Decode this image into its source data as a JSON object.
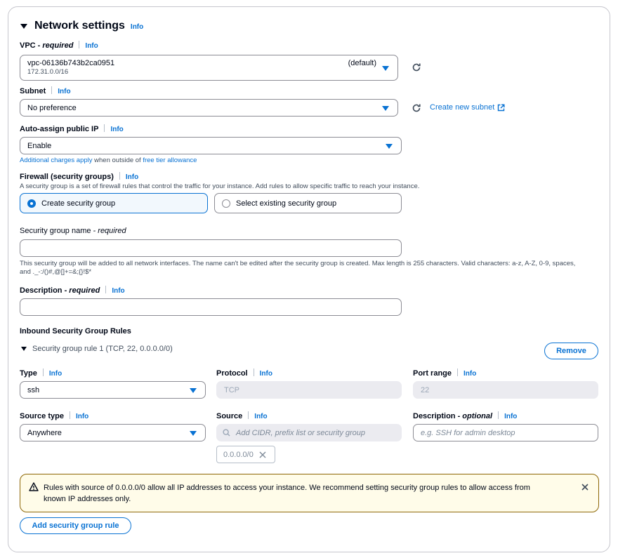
{
  "section": {
    "title": "Network settings",
    "info": "Info"
  },
  "vpc": {
    "label": "VPC - ",
    "label_req": "required",
    "info": "Info",
    "value": "vpc-06136b743b2ca0951",
    "sub": "172.31.0.0/16",
    "tag": "(default)"
  },
  "subnet": {
    "label": "Subnet",
    "info": "Info",
    "value": "No preference",
    "create_link": "Create new subnet"
  },
  "auto_ip": {
    "label": "Auto-assign public IP",
    "info": "Info",
    "value": "Enable",
    "note_link1": "Additional charges apply",
    "note_mid": " when outside of ",
    "note_link2": "free tier allowance"
  },
  "firewall": {
    "label": "Firewall (security groups)",
    "info": "Info",
    "desc": "A security group is a set of firewall rules that control the traffic for your instance. Add rules to allow specific traffic to reach your instance.",
    "opt_create": "Create security group",
    "opt_existing": "Select existing security group"
  },
  "sg_name": {
    "label": "Security group name",
    "label_req": " - required",
    "value": "",
    "help1": "This security group will be added to all network interfaces. The name can't be edited after the security group is created. Max length is 255 characters. Valid characters: a-z, A-Z, 0-9, spaces,",
    "help2": "and ._-:/()#,@[]+=&;{}!$*"
  },
  "description": {
    "label": "Description - ",
    "label_req": "required",
    "info": "Info",
    "value": ""
  },
  "inbound": {
    "title": "Inbound Security Group Rules",
    "rule_title": "Security group rule 1 (TCP, 22, 0.0.0.0/0)",
    "remove": "Remove",
    "type_label": "Type",
    "type_info": "Info",
    "type_value": "ssh",
    "protocol_label": "Protocol",
    "protocol_info": "Info",
    "protocol_value": "TCP",
    "port_label": "Port range",
    "port_info": "Info",
    "port_value": "22",
    "source_type_label": "Source type",
    "source_type_info": "Info",
    "source_type_value": "Anywhere",
    "source_label": "Source",
    "source_info": "Info",
    "source_placeholder": "Add CIDR, prefix list or security group",
    "source_token": "0.0.0.0/0",
    "desc_label": "Description - ",
    "desc_label_opt": "optional",
    "desc_info": "Info",
    "desc_placeholder": "e.g. SSH for admin desktop"
  },
  "warning": {
    "line1": "Rules with source of 0.0.0.0/0 allow all IP addresses to access your instance. We recommend setting security group rules to allow access from",
    "line2": "known IP addresses only."
  },
  "add_rule": "Add security group rule",
  "colors": {
    "accent": "#0972d3",
    "warning_bg": "#fffce9",
    "warning_border": "#8d6605"
  }
}
